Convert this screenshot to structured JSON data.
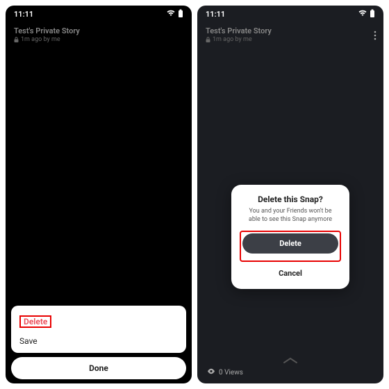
{
  "status": {
    "time": "11:11"
  },
  "story": {
    "title": "Test's Private Story",
    "subtitle": "1m ago by me"
  },
  "left": {
    "sheet": {
      "delete": "Delete",
      "save": "Save"
    },
    "done": "Done"
  },
  "right": {
    "modal": {
      "title": "Delete this Snap?",
      "message": "You and your Friends won't be able to see this Snap anymore",
      "delete": "Delete",
      "cancel": "Cancel"
    },
    "views": "0 Views"
  }
}
